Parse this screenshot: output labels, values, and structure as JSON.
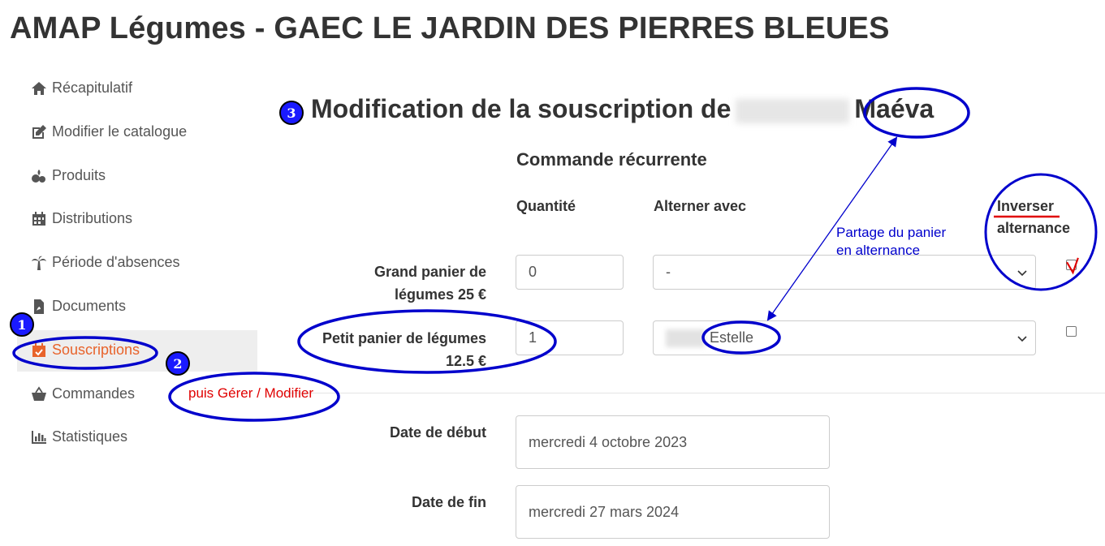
{
  "app": {
    "title": "AMAP Légumes - GAEC LE JARDIN DES PIERRES BLEUES"
  },
  "sidebar": {
    "items": [
      {
        "label": "Récapitulatif",
        "icon": "home-icon"
      },
      {
        "label": "Modifier le catalogue",
        "icon": "edit-icon"
      },
      {
        "label": "Produits",
        "icon": "products-icon"
      },
      {
        "label": "Distributions",
        "icon": "calendar-icon"
      },
      {
        "label": "Période d'absences",
        "icon": "palm-tree-icon"
      },
      {
        "label": "Documents",
        "icon": "pdf-file-icon"
      },
      {
        "label": "Souscriptions",
        "icon": "calendar-check-icon",
        "active": true
      },
      {
        "label": "Commandes",
        "icon": "basket-icon"
      },
      {
        "label": "Statistiques",
        "icon": "bar-chart-icon"
      }
    ]
  },
  "main": {
    "title_prefix": "Modification de la souscription de",
    "title_name": "Maéva",
    "section_title": "Commande récurrente",
    "columns": {
      "quantity": "Quantité",
      "alternate_with": "Alterner avec",
      "invert_line1": "Inverser",
      "invert_line2": "alternance"
    },
    "rows": [
      {
        "label_line1": "Grand panier de",
        "label_line2": "légumes 25 €",
        "quantity": "0",
        "alternate": "-",
        "invert_checked": true
      },
      {
        "label_line1": "Petit panier de légumes",
        "label_line2": "12.5 €",
        "quantity": "1",
        "alternate": "Estelle",
        "invert_checked": false
      }
    ],
    "dates": {
      "start_label": "Date de début",
      "start_value": "mercredi 4 octobre 2023",
      "end_label": "Date de fin",
      "end_value": "mercredi 27 mars 2024"
    }
  },
  "annotations": {
    "badge1": "1",
    "badge2": "2",
    "badge3": "3",
    "step2_text": "puis Gérer / Modifier",
    "share_line1": "Partage du panier",
    "share_line2": "en alternance",
    "colors": {
      "badge": "#1a1aff",
      "ellipse": "#0000cc",
      "step_text": "#e00000",
      "share_text": "#0000cc",
      "accent": "#e8632b"
    }
  }
}
